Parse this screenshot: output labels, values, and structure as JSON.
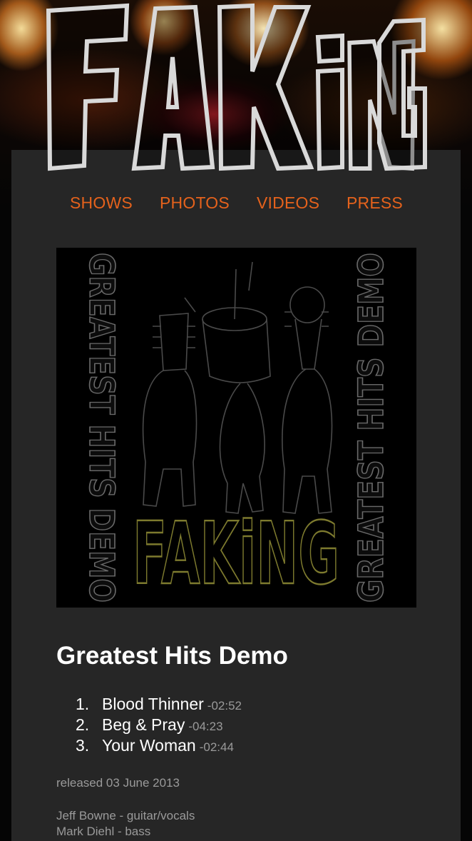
{
  "header": {
    "logo_text": "FAKING"
  },
  "nav": {
    "items": [
      {
        "label": "SHOWS"
      },
      {
        "label": "PHOTOS"
      },
      {
        "label": "VIDEOS"
      },
      {
        "label": "PRESS"
      }
    ]
  },
  "album": {
    "cover": {
      "band_name": "FAKiNG",
      "side_text": "GREATEST HITS DEMO"
    },
    "title": "Greatest Hits Demo",
    "tracks": [
      {
        "number": "1.",
        "name": "Blood Thinner",
        "duration": "-02:52"
      },
      {
        "number": "2.",
        "name": "Beg & Pray",
        "duration": "-04:23"
      },
      {
        "number": "3.",
        "name": "Your Woman",
        "duration": "-02:44"
      }
    ],
    "released": "released 03 June 2013",
    "credits": [
      "Jeff Bowne - guitar/vocals",
      "Mark Diehl - bass"
    ]
  },
  "colors": {
    "accent": "#e5621c",
    "panel": "#262626",
    "muted_text": "#9a9a9a",
    "cover_logo": "#7d7a2e"
  }
}
